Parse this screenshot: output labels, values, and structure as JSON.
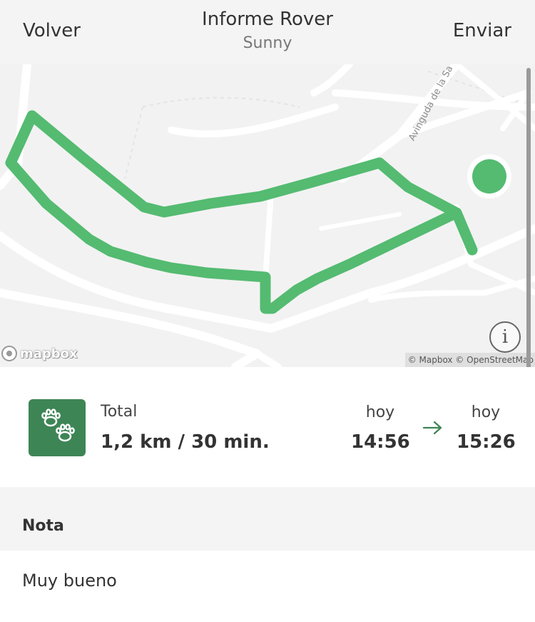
{
  "header": {
    "back_label": "Volver",
    "title": "Informe Rover",
    "subtitle": "Sunny",
    "send_label": "Enviar"
  },
  "map": {
    "street_label": "Avinguda de la Sa",
    "logo_text": "mapbox",
    "attribution": "© Mapbox © OpenStreetMap",
    "info_icon": "info-icon",
    "route_color": "#54bb71",
    "road_color": "#ffffff",
    "background_color": "#f2f2f2"
  },
  "summary": {
    "badge_icon": "paw-prints-icon",
    "badge_color": "#3e8555",
    "total_label": "Total",
    "total_value": "1,2 km / 30 min.",
    "start_day": "hoy",
    "start_time": "14:56",
    "arrow_icon": "arrow-right-icon",
    "end_day": "hoy",
    "end_time": "15:26"
  },
  "note": {
    "title": "Nota",
    "text": "Muy bueno"
  }
}
